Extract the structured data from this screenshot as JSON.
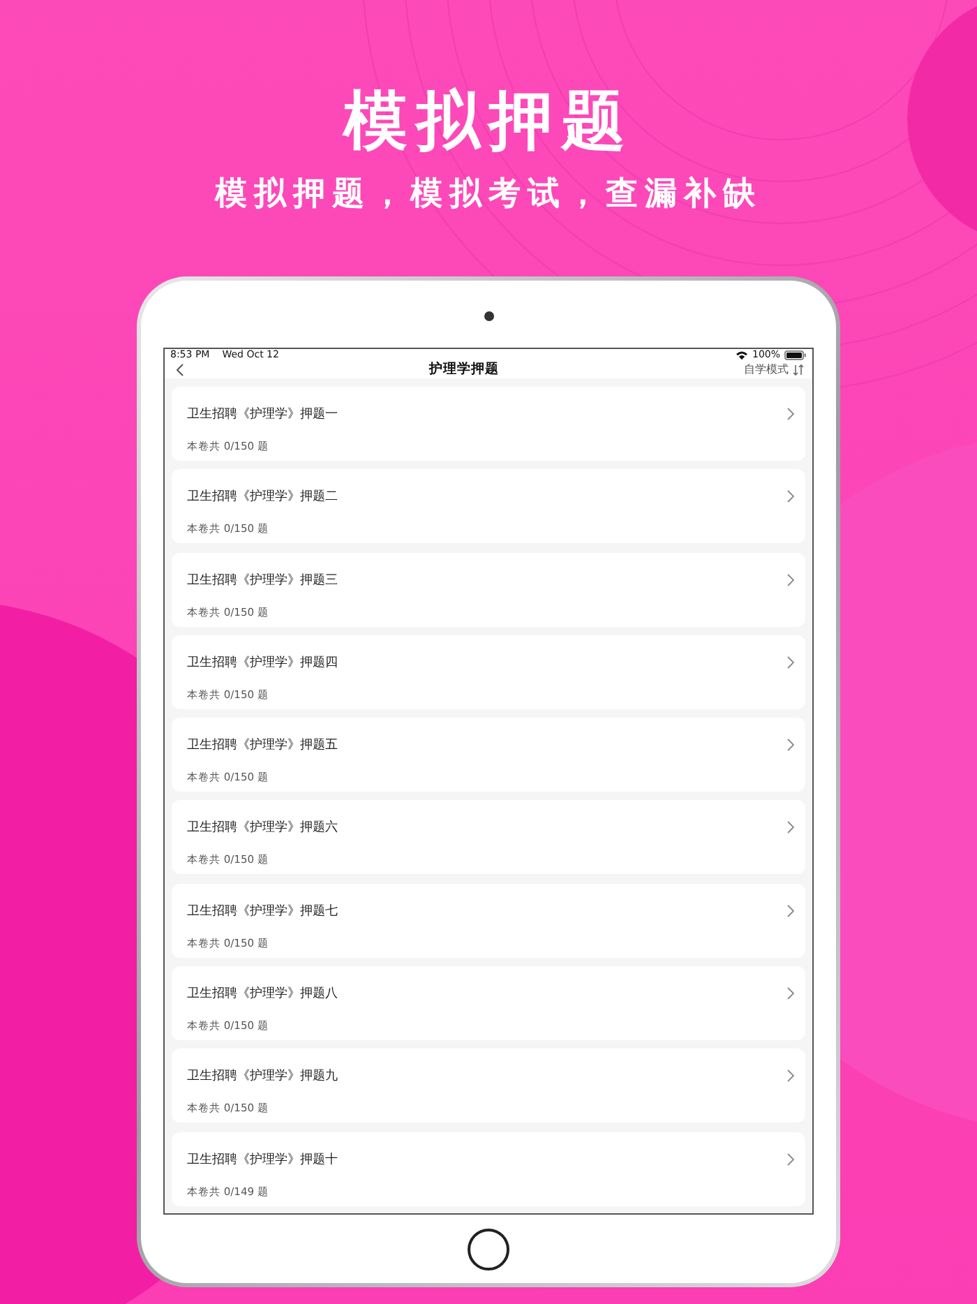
{
  "headline": "模拟押题",
  "subtitle": "模拟押题，模拟考试，查漏补缺",
  "status_bar": {
    "time": "8:53 PM",
    "date": "Wed Oct 12",
    "battery": "100%"
  },
  "nav": {
    "title": "护理学押题",
    "mode": "自学模式"
  },
  "papers": [
    {
      "title": "卫生招聘《护理学》押题一",
      "progress": "本卷共 0/150 题"
    },
    {
      "title": "卫生招聘《护理学》押题二",
      "progress": "本卷共 0/150 题"
    },
    {
      "title": "卫生招聘《护理学》押题三",
      "progress": "本卷共 0/150 题"
    },
    {
      "title": "卫生招聘《护理学》押题四",
      "progress": "本卷共 0/150 题"
    },
    {
      "title": "卫生招聘《护理学》押题五",
      "progress": "本卷共 0/150 题"
    },
    {
      "title": "卫生招聘《护理学》押题六",
      "progress": "本卷共 0/150 题"
    },
    {
      "title": "卫生招聘《护理学》押题七",
      "progress": "本卷共 0/150 题"
    },
    {
      "title": "卫生招聘《护理学》押题八",
      "progress": "本卷共 0/150 题"
    },
    {
      "title": "卫生招聘《护理学》押题九",
      "progress": "本卷共 0/150 题"
    },
    {
      "title": "卫生招聘《护理学》押题十",
      "progress": "本卷共 0/149 题"
    }
  ]
}
